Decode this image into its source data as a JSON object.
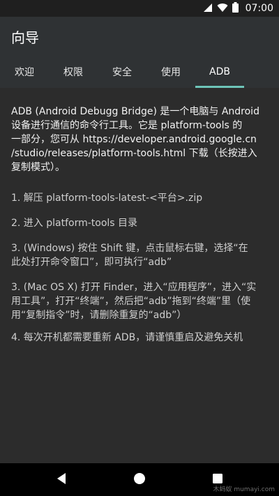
{
  "status_bar": {
    "time": "07:00",
    "icons": [
      "signal-icon",
      "wifi-icon",
      "battery-icon"
    ]
  },
  "app_bar": {
    "title": "向导",
    "tabs": [
      {
        "label": "欢迎",
        "active": false
      },
      {
        "label": "权限",
        "active": false
      },
      {
        "label": "安全",
        "active": false
      },
      {
        "label": "使用",
        "active": false
      },
      {
        "label": "ADB",
        "active": true
      }
    ],
    "accent_color": "#6ec5b9"
  },
  "content": {
    "intro": "ADB (Android Debugg Bridge) 是一个电脑与 Android\n设备进行通信的命令行工具。它是 platform-tools 的\n一部分，您可从 https://developer.android.google.cn\n/studio/releases/platform-tools.html 下载（长按进入\n复制模式）。",
    "steps": [
      "1. 解压 platform-tools-latest-<平台>.zip",
      "2. 进入 platform-tools 目录",
      "3. (Windows) 按住 Shift 键，点击鼠标右键，选择“在\n此处打开命令窗口”，即可执行“adb”",
      "3. (Mac OS X) 打开 Finder，进入“应用程序”，进入“实\n用工具”，打开“终端”，然后把“adb”拖到“终端”里（使\n用“复制指令”时，请删除重复的“adb”）",
      "4. 每次开机都需要重新 ADB，请谨慎重启及避免关机"
    ]
  },
  "nav_bar": {
    "buttons": [
      "back-icon",
      "home-icon",
      "recents-icon"
    ]
  },
  "watermark": "木蚂蚁 mumayi.com"
}
